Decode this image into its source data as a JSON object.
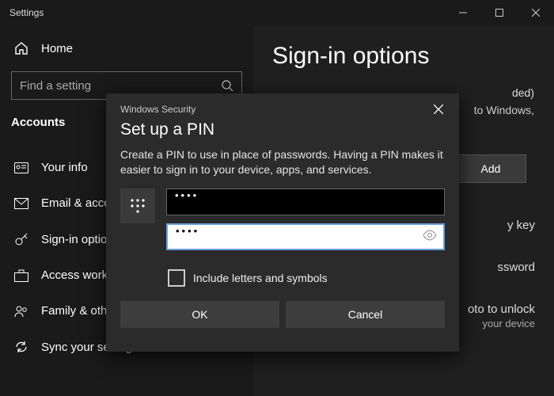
{
  "window": {
    "title": "Settings"
  },
  "sidebar": {
    "home": "Home",
    "search_placeholder": "Find a setting",
    "section": "Accounts",
    "items": [
      {
        "label": "Your info"
      },
      {
        "label": "Email & accounts"
      },
      {
        "label": "Sign-in options"
      },
      {
        "label": "Access work or school"
      },
      {
        "label": "Family & other users"
      },
      {
        "label": "Sync your settings"
      }
    ]
  },
  "main": {
    "heading": "Sign-in options",
    "pin_recommended_suffix": "ded)",
    "pin_desc_tail": "to Windows,",
    "add_label": "Add",
    "sec_key_tail": "y key",
    "password_tail": "ssword",
    "picture_tail": "oto to unlock",
    "picture_tail2": "your device"
  },
  "dialog": {
    "app": "Windows Security",
    "title": "Set up a PIN",
    "desc": "Create a PIN to use in place of passwords. Having a PIN makes it easier to sign in to your device, apps, and services.",
    "pin_value": "••••",
    "pin_confirm_value": "••••",
    "include_label": "Include letters and symbols",
    "ok": "OK",
    "cancel": "Cancel"
  }
}
